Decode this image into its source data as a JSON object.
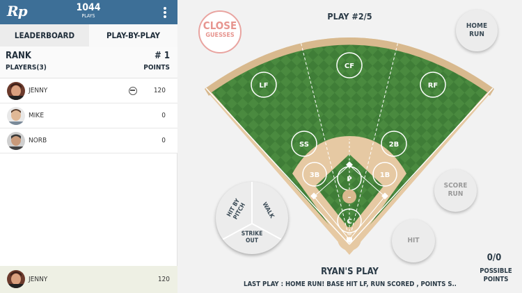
{
  "header": {
    "logo": "Rp",
    "plays_count": "1044",
    "plays_label": "PLAYS",
    "menu_icon": "kebab-menu-icon"
  },
  "tabs": [
    {
      "label": "LEADERBOARD",
      "active": true
    },
    {
      "label": "PLAY-BY-PLAY",
      "active": false
    }
  ],
  "rank_header": {
    "rank_label": "RANK",
    "players_label": "PLAYERS(3)",
    "rank_value": "# 1",
    "points_label": "POINTS"
  },
  "players": [
    {
      "name": "JENNY",
      "score": "120",
      "icon": "baseball-icon"
    },
    {
      "name": "MIKE",
      "score": "0"
    },
    {
      "name": "NORB",
      "score": "0"
    }
  ],
  "footer": {
    "name": "JENNY",
    "score": "120"
  },
  "play": {
    "title": "PLAY #2/5",
    "owner": "RYAN'S PLAY",
    "last_play": "LAST PLAY : HOME RUN! BASE HIT LF, RUN SCORED , POINTS S..."
  },
  "score": {
    "value": "0/0",
    "label_line1": "POSSIBLE",
    "label_line2": "POINTS"
  },
  "buttons": {
    "close_line1": "CLOSE",
    "close_line2": "GUESSES",
    "home_run_line1": "HOME",
    "home_run_line2": "RUN",
    "score_run_line1": "SCORE",
    "score_run_line2": "RUN",
    "hit": "HIT",
    "hbp": "HIT BY PITCH",
    "walk": "WALK",
    "strike_out_line1": "STRIKE",
    "strike_out_line2": "OUT"
  },
  "positions": {
    "lf": "LF",
    "cf": "CF",
    "rf": "RF",
    "ss": "SS",
    "2b": "2B",
    "3b": "3B",
    "1b": "1B",
    "p": "P",
    "c": "C",
    "minus": "–"
  },
  "colors": {
    "header_blue": "#3d6f97",
    "grass": "#4a8a3f",
    "dirt": "#e6c9a3",
    "close_pink": "#e7958f"
  }
}
